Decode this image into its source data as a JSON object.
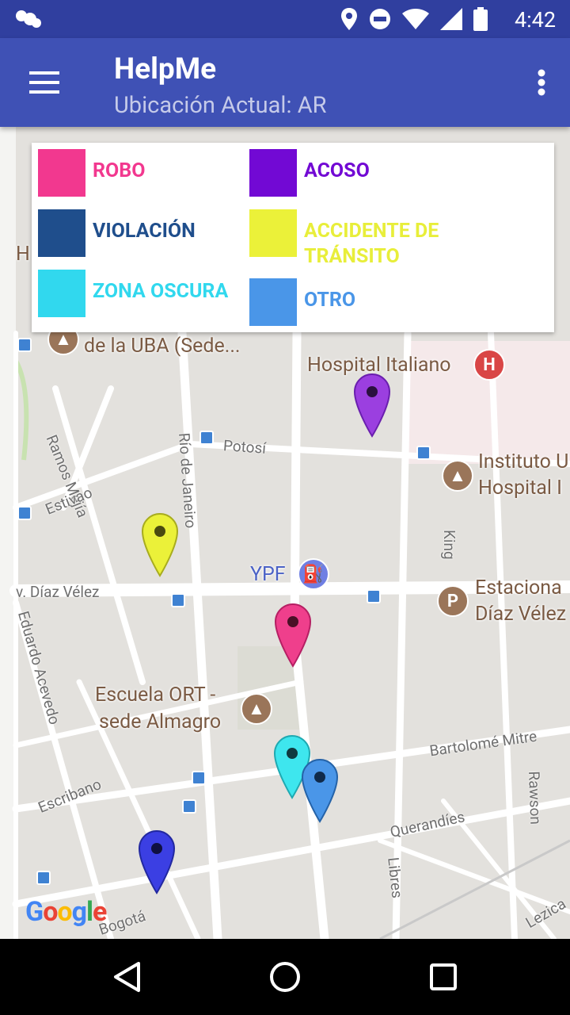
{
  "status_bar": {
    "time": "4:42",
    "icons": [
      "weather-icon",
      "location-icon",
      "do-not-disturb-icon",
      "wifi-icon",
      "signal-icon",
      "battery-icon"
    ]
  },
  "app_bar": {
    "title": "HelpMe",
    "subtitle": "Ubicación Actual: AR",
    "menu_icon": "menu-icon",
    "overflow_icon": "more-vert-icon",
    "background": "#3f51b5"
  },
  "legend": {
    "items": [
      {
        "label": "ROBO",
        "color": "#f2388f"
      },
      {
        "label": "ACOSO",
        "color": "#7209d4"
      },
      {
        "label": "VIOLACIÓN",
        "color": "#1f4e8c"
      },
      {
        "label": "ACCIDENTE DE TRÁNSITO",
        "color": "#ebf139"
      },
      {
        "label": "ZONA OSCURA",
        "color": "#31d8ee"
      },
      {
        "label": "OTRO",
        "color": "#4a96e8"
      }
    ]
  },
  "map": {
    "places": {
      "uba": "de la UBA (Sede...",
      "hospital": "Hospital Italiano",
      "instituto_1": "Instituto U",
      "instituto_2": "Hospital I",
      "ypf": "YPF",
      "estacionamiento_1": "Estaciona",
      "estacionamiento_2": "Díaz Vélez",
      "escuela_1": "Escuela ORT -",
      "escuela_2": "sede Almagro",
      "h_partial": "H"
    },
    "streets": {
      "ramos_mejia": "Ramos Mejía",
      "potosi": "Potosí",
      "rio_de_janeiro": "Río de Janeiro",
      "estivao": "Estivao",
      "king": "King",
      "diaz_velez": "v. Díaz Vélez",
      "eduardo_acevedo": "Eduardo Acevedo",
      "bartolome_mitre": "Bartolomé Mitre",
      "escribano": "Escribano",
      "querandies": "Querandíes",
      "rawson": "Rawson",
      "libres": "Libres",
      "bogota": "Bogotá",
      "lezica": "Lezica"
    },
    "pins": [
      {
        "category": "ACOSO",
        "color": "#9b3fe0"
      },
      {
        "category": "ACCIDENTE DE TRÁNSITO",
        "color": "#ebf139"
      },
      {
        "category": "ROBO",
        "color": "#ef3f8c"
      },
      {
        "category": "ZONA OSCURA",
        "color": "#3ee6ee"
      },
      {
        "category": "OTRO",
        "color": "#4a96e8"
      },
      {
        "category": "VIOLACIÓN",
        "color": "#3b3fe3"
      }
    ],
    "google": "Google"
  },
  "nav_bar": {
    "back_icon": "back-icon",
    "home_icon": "home-icon",
    "recents_icon": "recents-icon"
  }
}
